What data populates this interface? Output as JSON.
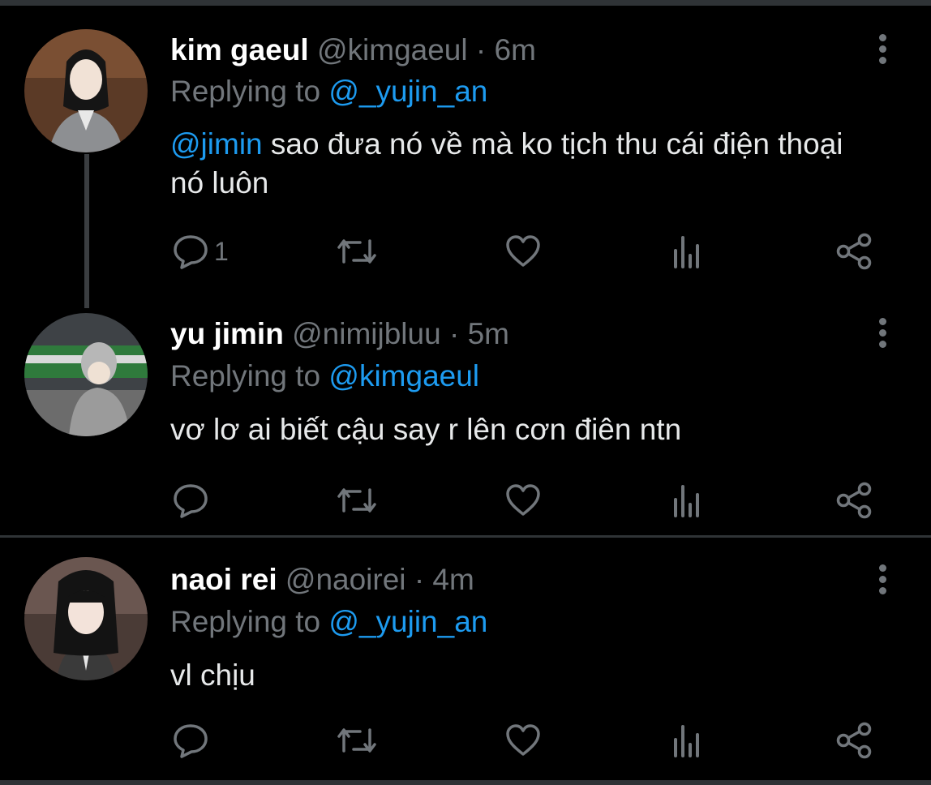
{
  "tweets": [
    {
      "name": "kim gaeul",
      "handle": "@kimgaeul",
      "separator": "·",
      "time": "6m",
      "replying_label": "Replying to",
      "replying_to": "@_yujin_an",
      "body_mention": "@jimin",
      "body_text": " sao đưa nó về mà ko tịch thu cái điện thoại nó luôn",
      "reply_count": "1",
      "avatar_icon": "avatar-photo"
    },
    {
      "name": "yu jimin",
      "handle": "@nimijbluu",
      "separator": "·",
      "time": "5m",
      "replying_label": "Replying to",
      "replying_to": "@kimgaeul",
      "body_mention": "",
      "body_text": "vơ lơ ai biết cậu say r lên cơn điên ntn",
      "reply_count": "",
      "avatar_icon": "avatar-photo"
    },
    {
      "name": "naoi rei",
      "handle": "@naoirei",
      "separator": "·",
      "time": "4m",
      "replying_label": "Replying to",
      "replying_to": "@_yujin_an",
      "body_mention": "",
      "body_text": "vl chịu",
      "reply_count": "",
      "avatar_icon": "avatar-photo"
    }
  ],
  "icons": {
    "reply": "reply-icon",
    "retweet": "retweet-icon",
    "like": "like-icon",
    "views": "views-icon",
    "share": "share-icon",
    "more": "more-icon"
  },
  "colors": {
    "background": "#000000",
    "mention": "#1d9bf0",
    "muted": "#71767b",
    "divider": "#2f3336"
  }
}
